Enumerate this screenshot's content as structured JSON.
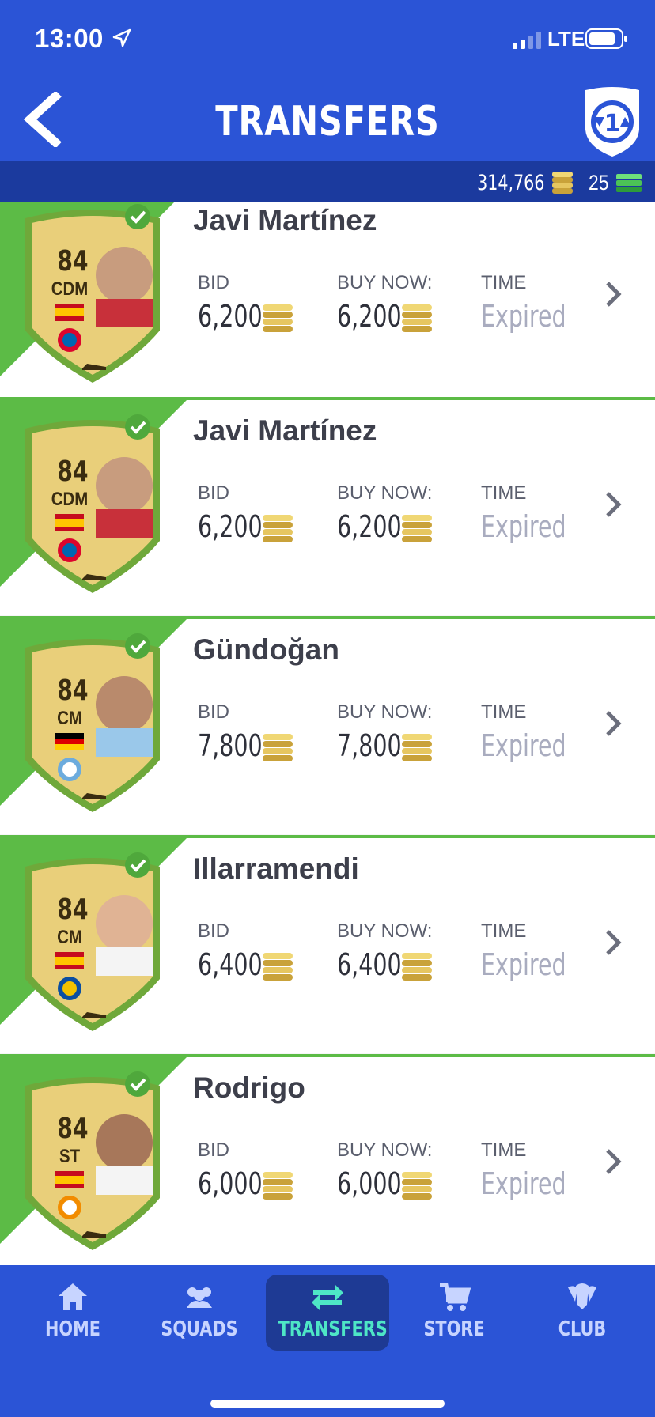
{
  "status_bar": {
    "time": "13:00",
    "network": "LTE"
  },
  "header": {
    "title": "TRANSFERS"
  },
  "currency": {
    "coins": "314,766",
    "points": "25"
  },
  "list_labels": {
    "bid": "BID",
    "buy_now": "BUY NOW:",
    "time": "TIME"
  },
  "items": [
    {
      "name": "Javi Martínez",
      "rating": "84",
      "position": "CDM",
      "bid": "6,200",
      "buy_now": "6,200",
      "time": "Expired",
      "nation": "Spain",
      "club": "Bayern"
    },
    {
      "name": "Javi Martínez",
      "rating": "84",
      "position": "CDM",
      "bid": "6,200",
      "buy_now": "6,200",
      "time": "Expired",
      "nation": "Spain",
      "club": "Bayern"
    },
    {
      "name": "Gündoğan",
      "rating": "84",
      "position": "CM",
      "bid": "7,800",
      "buy_now": "7,800",
      "time": "Expired",
      "nation": "Germany",
      "club": "Man City"
    },
    {
      "name": "Illarramendi",
      "rating": "84",
      "position": "CM",
      "bid": "6,400",
      "buy_now": "6,400",
      "time": "Expired",
      "nation": "Spain",
      "club": "Real Sociedad"
    },
    {
      "name": "Rodrigo",
      "rating": "84",
      "position": "ST",
      "bid": "6,000",
      "buy_now": "6,000",
      "time": "Expired",
      "nation": "Spain",
      "club": "Valencia"
    }
  ],
  "tabs": [
    {
      "label": "HOME",
      "icon": "home-icon",
      "active": false
    },
    {
      "label": "SQUADS",
      "icon": "squads-icon",
      "active": false
    },
    {
      "label": "TRANSFERS",
      "icon": "transfers-icon",
      "active": true
    },
    {
      "label": "STORE",
      "icon": "cart-icon",
      "active": false
    },
    {
      "label": "CLUB",
      "icon": "club-icon",
      "active": false
    }
  ],
  "colors": {
    "primary": "#2b54d6",
    "dark_bar": "#1b3a9e",
    "accent_green": "#5cbb46",
    "active_tab_text": "#4ee6c6",
    "expired_text": "#a9acbf"
  }
}
